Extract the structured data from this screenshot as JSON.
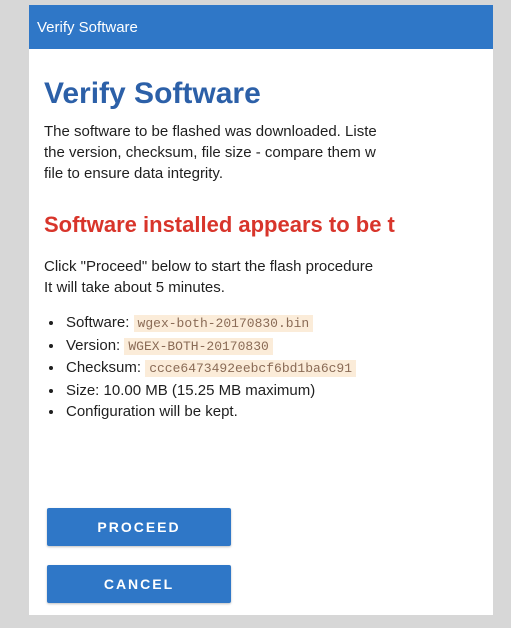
{
  "window": {
    "title": "Verify Software"
  },
  "page": {
    "heading": "Verify Software",
    "intro_lines": [
      "The software to be flashed was downloaded. Liste",
      "the version, checksum, file size - compare them w",
      "file to ensure data integrity."
    ],
    "status_heading": "Software installed appears to be t",
    "instructions": [
      "Click \"Proceed\" below to start the flash procedure",
      "It will take about 5 minutes."
    ],
    "details": {
      "software_label": "Software:",
      "software_value": "wgex-both-20170830.bin",
      "version_label": "Version:",
      "version_value": "WGEX-BOTH-20170830",
      "checksum_label": "Checksum:",
      "checksum_value": "ccce6473492eebcf6bd1ba6c91",
      "size_text": "Size: 10.00 MB (15.25 MB maximum)",
      "config_text": "Configuration will be kept."
    }
  },
  "buttons": {
    "proceed": "PROCEED",
    "cancel": "CANCEL"
  },
  "colors": {
    "titlebar": "#2f77c7",
    "heading": "#2c60a8",
    "warning": "#d8352b",
    "button": "#2f77c7",
    "code_bg": "#fbecd9"
  }
}
